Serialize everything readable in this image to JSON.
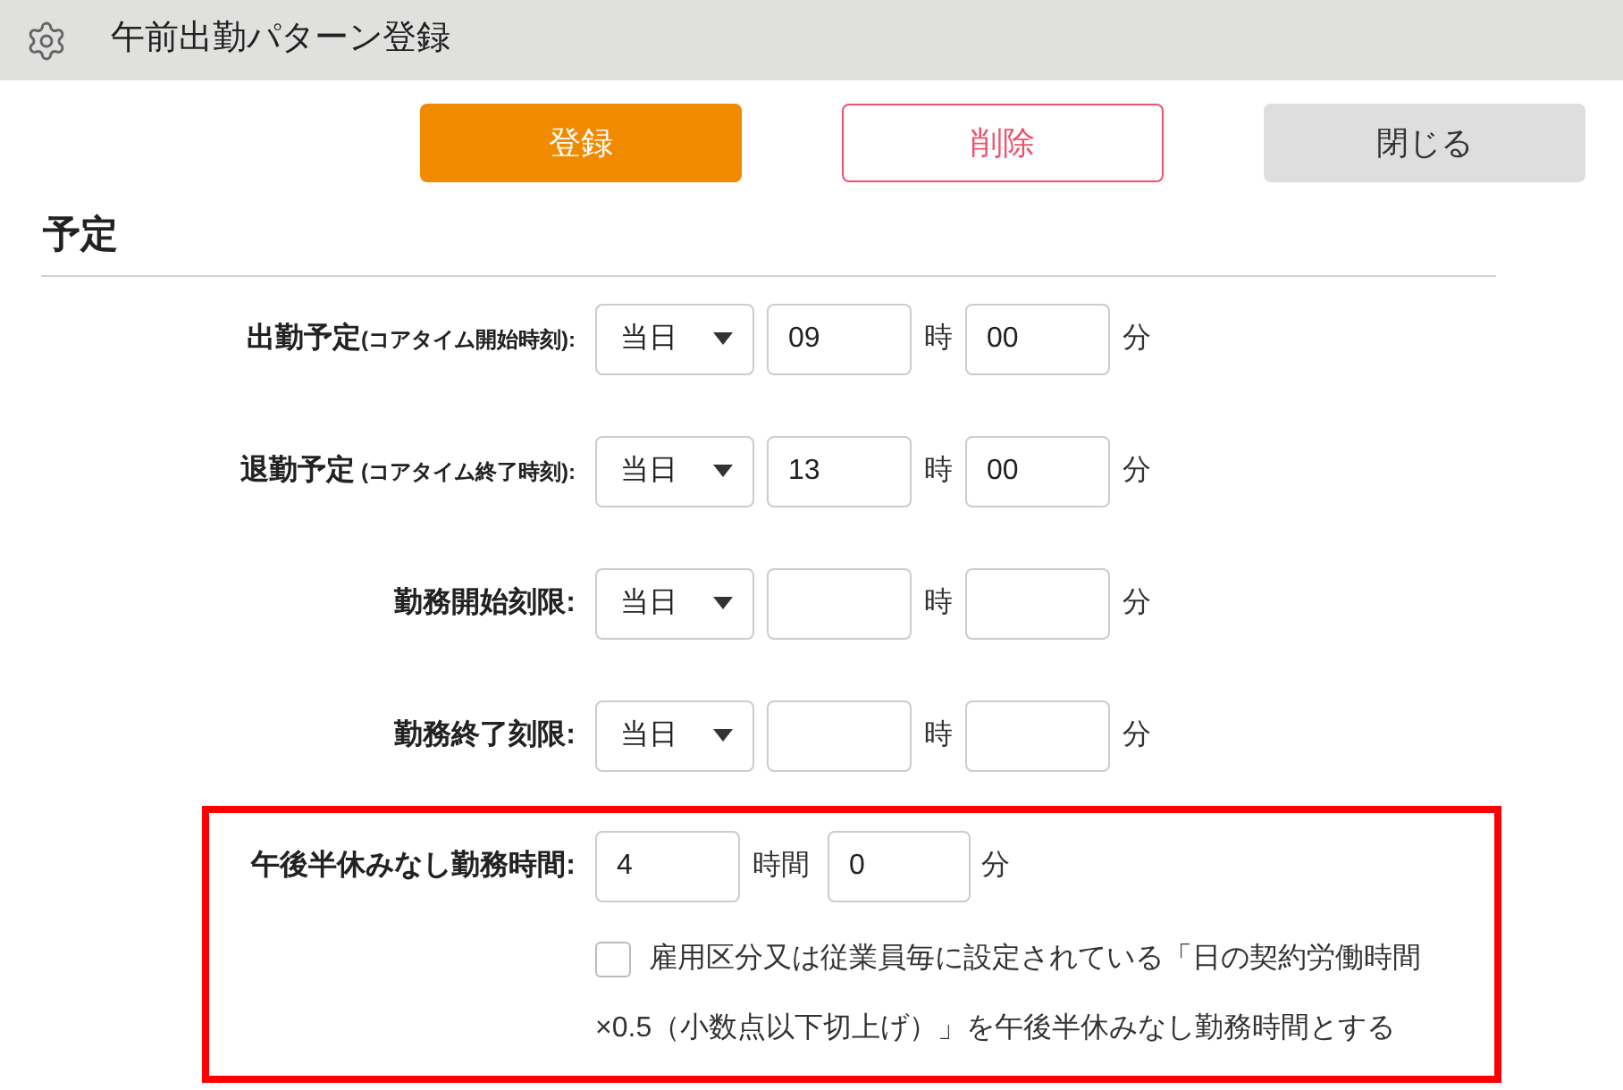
{
  "window": {
    "title": "午前出勤パターン登録"
  },
  "buttons": [
    {
      "label": "登録",
      "kind": "primary"
    },
    {
      "label": "削除",
      "kind": "danger"
    },
    {
      "label": "閉じる",
      "kind": "secondary"
    }
  ],
  "section": {
    "title": "予定"
  },
  "schedule_rows": [
    {
      "label": "出勤予定",
      "note": "(コアタイム開始時刻):",
      "day": "当日",
      "hour": "09",
      "hour_unit": "時",
      "minute": "00",
      "minute_unit": "分"
    },
    {
      "label": "退勤予定",
      "note": " (コアタイム終了時刻):",
      "day": "当日",
      "hour": "13",
      "hour_unit": "時",
      "minute": "00",
      "minute_unit": "分"
    },
    {
      "label": "勤務開始刻限:",
      "day": "当日",
      "hour_unit": "時",
      "minute_unit": "分"
    },
    {
      "label": "勤務終了刻限:",
      "day": "当日",
      "hour_unit": "時",
      "minute_unit": "分"
    }
  ],
  "half_day": {
    "highlighted": true,
    "label": "午後半休みなし勤務時間:",
    "hours": "4",
    "hours_unit": "時間",
    "minutes": "0",
    "minutes_unit": "分",
    "option": {
      "checked": false,
      "lines": [
        "雇用区分又は従業員毎に設定されている「日の契約労働時間",
        "×0.5（小数点以下切上げ）」を午後半休みなし勤務時間とする"
      ]
    }
  }
}
